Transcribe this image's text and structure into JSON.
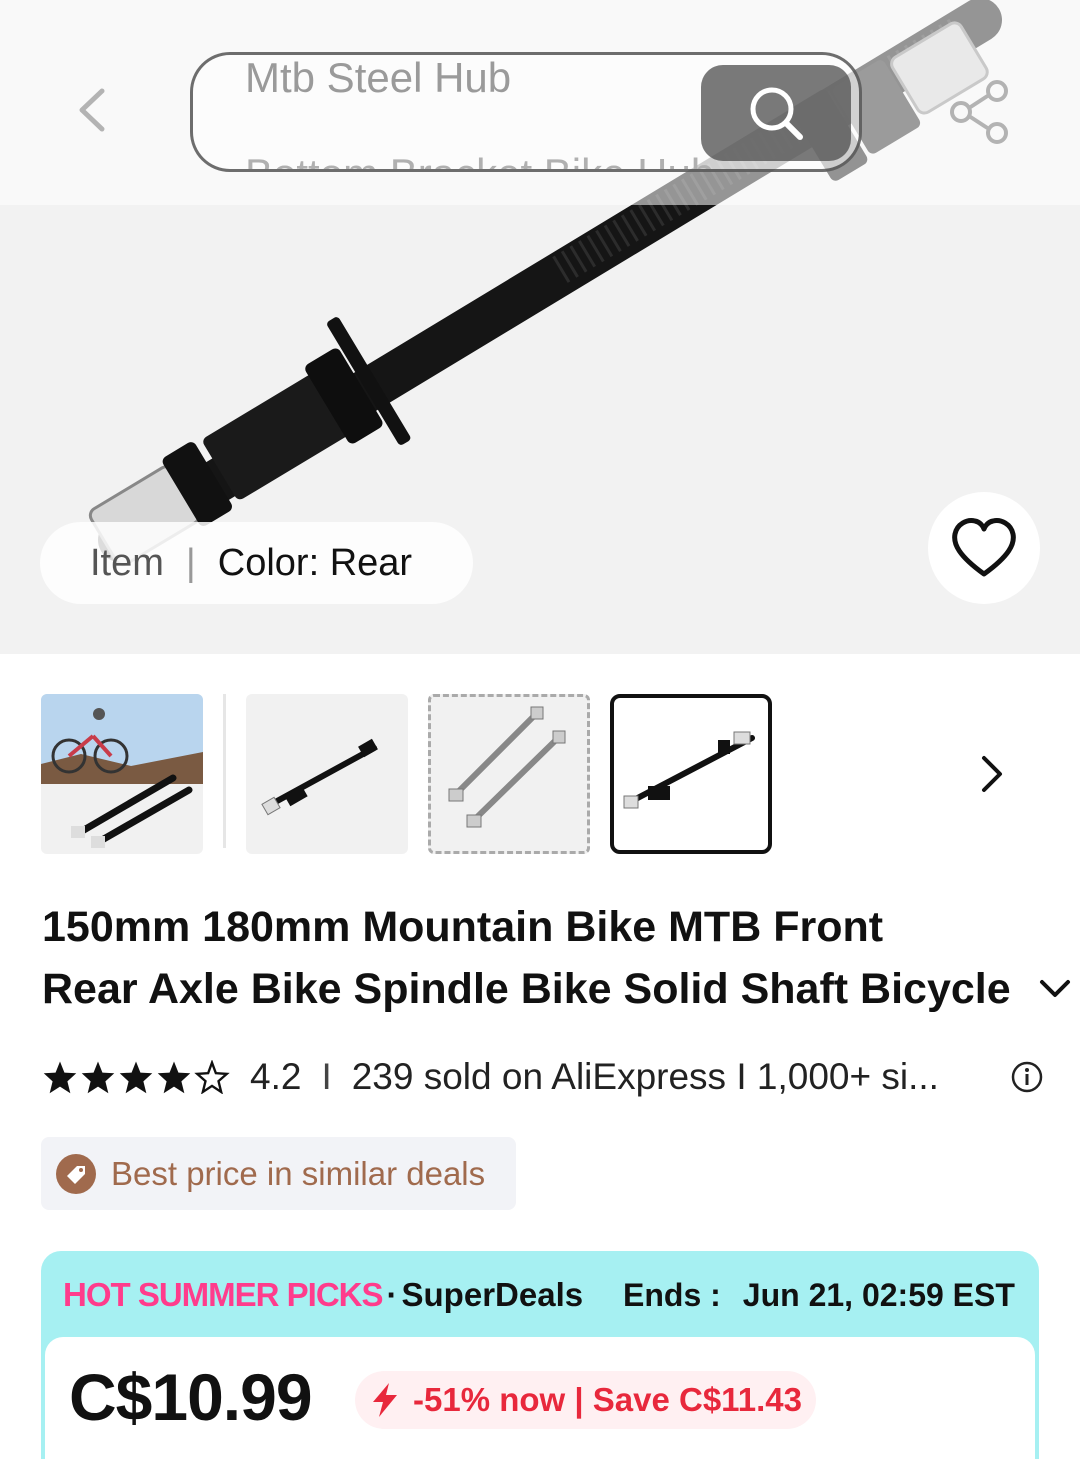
{
  "search": {
    "placeholder": "Mtb Steel Hub",
    "ghost_text": "Bottom Bracket Bike Hub"
  },
  "variant": {
    "label": "Item",
    "value": "Color: Rear"
  },
  "product": {
    "title_line_1": "150mm 180mm Mountain Bike MTB Front",
    "title_line_2": "Rear Axle Bike Spindle Bike Solid Shaft Bicycle",
    "rating": "4.2",
    "rating_stars": 4.2,
    "rating_separator": "I",
    "sold_text": "239 sold on AliExpress I 1,000+ si..."
  },
  "badge": {
    "best_price": "Best price in similar deals"
  },
  "deal": {
    "hot_label": "HOT SUMMER PICKS",
    "dot": "·",
    "super_label": "SuperDeals",
    "ends_label": "Ends :",
    "ends_value": "Jun 21, 02:59 EST",
    "price": "C$10.99",
    "discount_text": "-51% now | Save C$11.43"
  },
  "colors": {
    "hot_pink": "#ff3c8c",
    "deal_bg": "#a6f0f2",
    "discount_red": "#e8283c",
    "badge_brown": "#a06a4d"
  },
  "icons": {
    "back": "chevron-left-icon",
    "search": "search-icon",
    "share": "share-icon",
    "wishlist": "heart-icon",
    "next": "chevron-right-icon",
    "expand": "chevron-down-icon",
    "info": "info-icon",
    "price_tag": "price-tag-icon",
    "flash": "flash-icon"
  }
}
